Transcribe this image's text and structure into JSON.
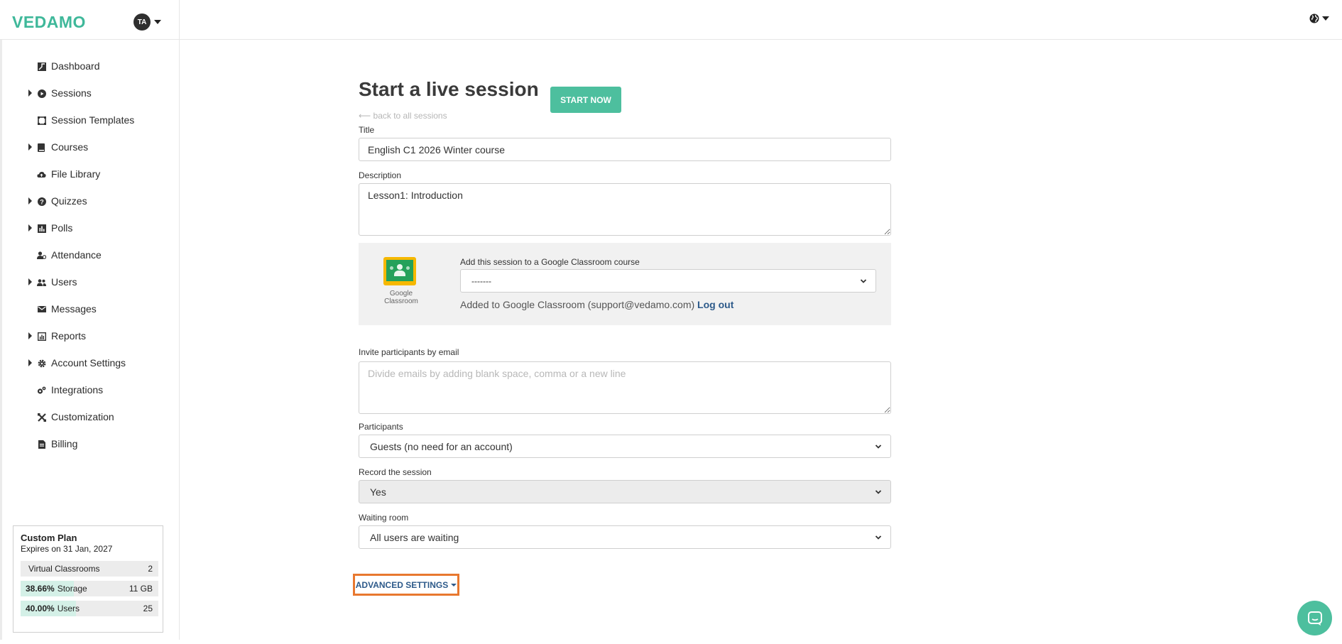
{
  "brand": {
    "logo_text": "VEDAMO",
    "avatar_initials": "TA"
  },
  "sidebar": {
    "items": [
      {
        "label": "Dashboard",
        "icon": "dashboard-icon",
        "expandable": false
      },
      {
        "label": "Sessions",
        "icon": "play-icon",
        "expandable": true
      },
      {
        "label": "Session Templates",
        "icon": "templates-icon",
        "expandable": false
      },
      {
        "label": "Courses",
        "icon": "book-icon",
        "expandable": true
      },
      {
        "label": "File Library",
        "icon": "cloud-upload-icon",
        "expandable": false
      },
      {
        "label": "Quizzes",
        "icon": "question-icon",
        "expandable": true
      },
      {
        "label": "Polls",
        "icon": "poll-icon",
        "expandable": true
      },
      {
        "label": "Attendance",
        "icon": "attendance-icon",
        "expandable": false
      },
      {
        "label": "Users",
        "icon": "users-icon",
        "expandable": true
      },
      {
        "label": "Messages",
        "icon": "envelope-icon",
        "expandable": false
      },
      {
        "label": "Reports",
        "icon": "reports-icon",
        "expandable": true
      },
      {
        "label": "Account Settings",
        "icon": "gear-icon",
        "expandable": true
      },
      {
        "label": "Integrations",
        "icon": "integrations-icon",
        "expandable": false
      },
      {
        "label": "Customization",
        "icon": "tools-icon",
        "expandable": false
      },
      {
        "label": "Billing",
        "icon": "billing-icon",
        "expandable": false
      }
    ]
  },
  "plan": {
    "title": "Custom Plan",
    "expires": "Expires on 31 Jan, 2027",
    "rows": [
      {
        "pct": "",
        "label": "Virtual Classrooms",
        "value": "2",
        "fill": 0
      },
      {
        "pct": "38.66%",
        "label": "Storage",
        "value": "11 GB",
        "fill": 0.3866
      },
      {
        "pct": "40.00%",
        "label": "Users",
        "value": "25",
        "fill": 0.4
      }
    ]
  },
  "form": {
    "page_title": "Start a live session",
    "start_button": "START NOW",
    "back_link": "⟵ back to all sessions",
    "title_label": "Title",
    "title_value": "English C1 2026 Winter course",
    "description_label": "Description",
    "description_value": "Lesson1: Introduction",
    "google_classroom": {
      "logo_text": "Google Classroom",
      "label": "Add this session to a Google Classroom course",
      "selected": "-------",
      "status_text": "Added to Google Classroom (support@vedamo.com)",
      "logout_label": "Log out"
    },
    "invite_label": "Invite participants by email",
    "invite_placeholder": "Divide emails by adding blank space, comma or a new line",
    "participants_label": "Participants",
    "participants_value": "Guests (no need for an account)",
    "record_label": "Record the session",
    "record_value": "Yes",
    "waiting_label": "Waiting room",
    "waiting_value": "All users are waiting",
    "advanced_settings": "ADVANCED SETTINGS"
  },
  "colors": {
    "accent": "#4dbf9e",
    "link": "#2d5a8a",
    "highlight": "#e8782f"
  }
}
